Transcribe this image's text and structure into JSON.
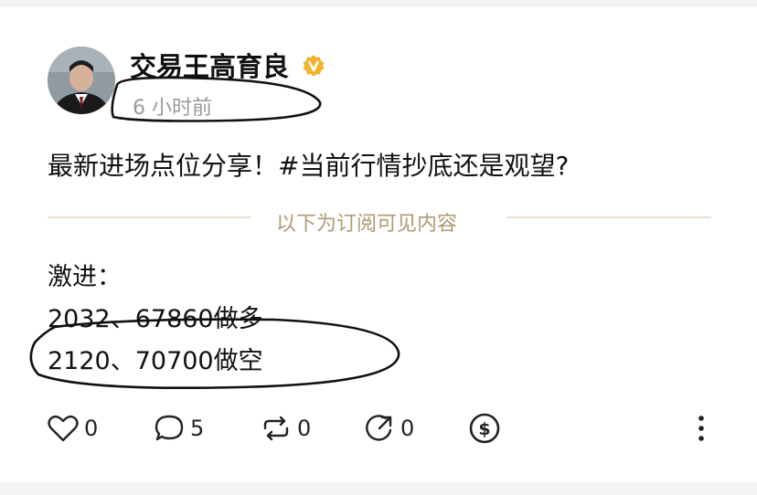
{
  "post": {
    "author": "交易王高育良",
    "time": "6 小时前",
    "text": "最新进场点位分享！#当前行情抄底还是观望?",
    "divider_text": "以下为订阅可见内容",
    "lines": [
      "激进：",
      "2032、67860做多",
      "2120、70700做空"
    ]
  },
  "actions": {
    "like_count": "0",
    "comment_count": "5",
    "repost_count": "0",
    "share_count": "0"
  },
  "icons": {
    "avatar": "avatar-photo",
    "verified": "verified-badge-icon",
    "like": "heart-icon",
    "comment": "comment-bubble-icon",
    "repost": "repost-icon",
    "share": "share-arrow-icon",
    "tip": "dollar-coin-icon",
    "more": "more-vertical-icon"
  },
  "colors": {
    "verified_badge": "#f2b32b",
    "divider_text": "#b09a73",
    "timestamp": "#9a9a9a"
  }
}
